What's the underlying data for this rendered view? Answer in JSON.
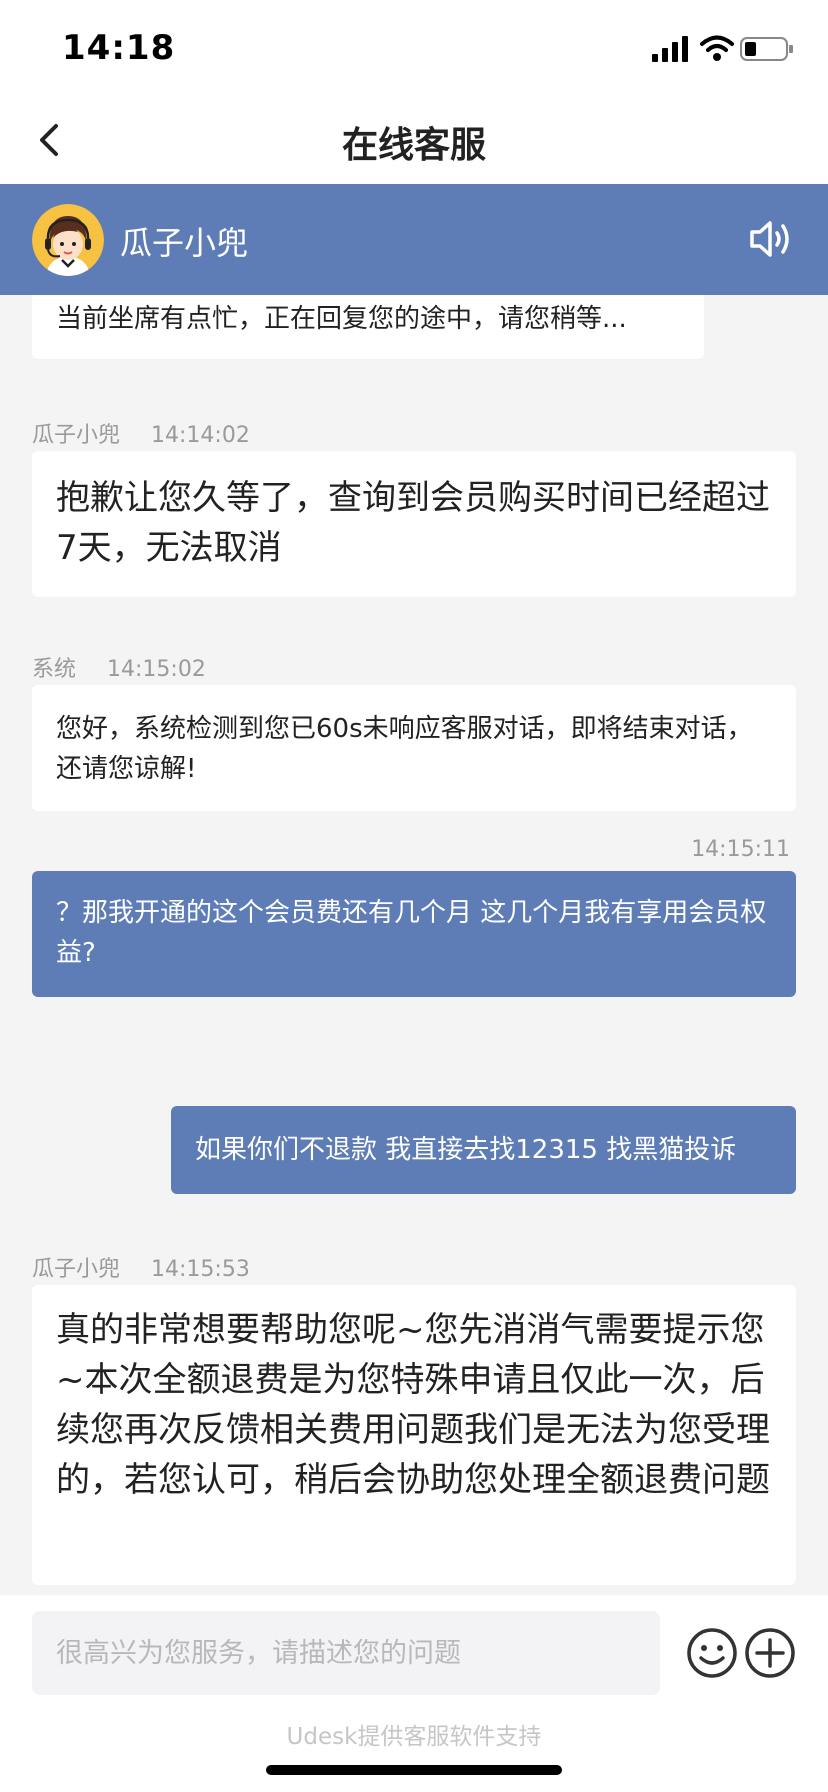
{
  "status": {
    "time": "14:18"
  },
  "nav": {
    "title": "在线客服"
  },
  "agent": {
    "name": "瓜子小兜"
  },
  "messages": [
    {
      "text": "当前坐席有点忙，正在回复您的途中，请您稍等..."
    },
    {
      "sender": "瓜子小兜",
      "time": "14:14:02",
      "text": "抱歉让您久等了，查询到会员购买时间已经超过7天，无法取消"
    },
    {
      "sender": "系统",
      "time": "14:15:02",
      "text": "您好，系统检测到您已60s未响应客服对话，即将结束对话，还请您谅解!"
    },
    {
      "time": "14:15:11",
      "text": "？那我开通的这个会员费还有几个月 这几个月我有享用会员权益?"
    },
    {
      "text": "如果你们不退款 我直接去找12315 找黑猫投诉"
    },
    {
      "sender": "瓜子小兜",
      "time": "14:15:53",
      "text": "真的非常想要帮助您呢~您先消消气需要提示您~本次全额退费是为您特殊申请且仅此一次，后续您再次反馈相关费用问题我们是无法为您受理的，若您认可，稍后会协助您处理全额退费问题"
    }
  ],
  "input": {
    "placeholder": "很高兴为您服务，请描述您的问题"
  },
  "footer": {
    "text": "Udesk提供客服软件支持"
  },
  "colors": {
    "accent": "#5e7db6",
    "background": "#f4f4f5"
  },
  "icons": [
    "back-chevron-icon",
    "speaker-icon",
    "emoji-icon",
    "plus-icon",
    "signal-icon",
    "wifi-icon",
    "battery-icon"
  ]
}
